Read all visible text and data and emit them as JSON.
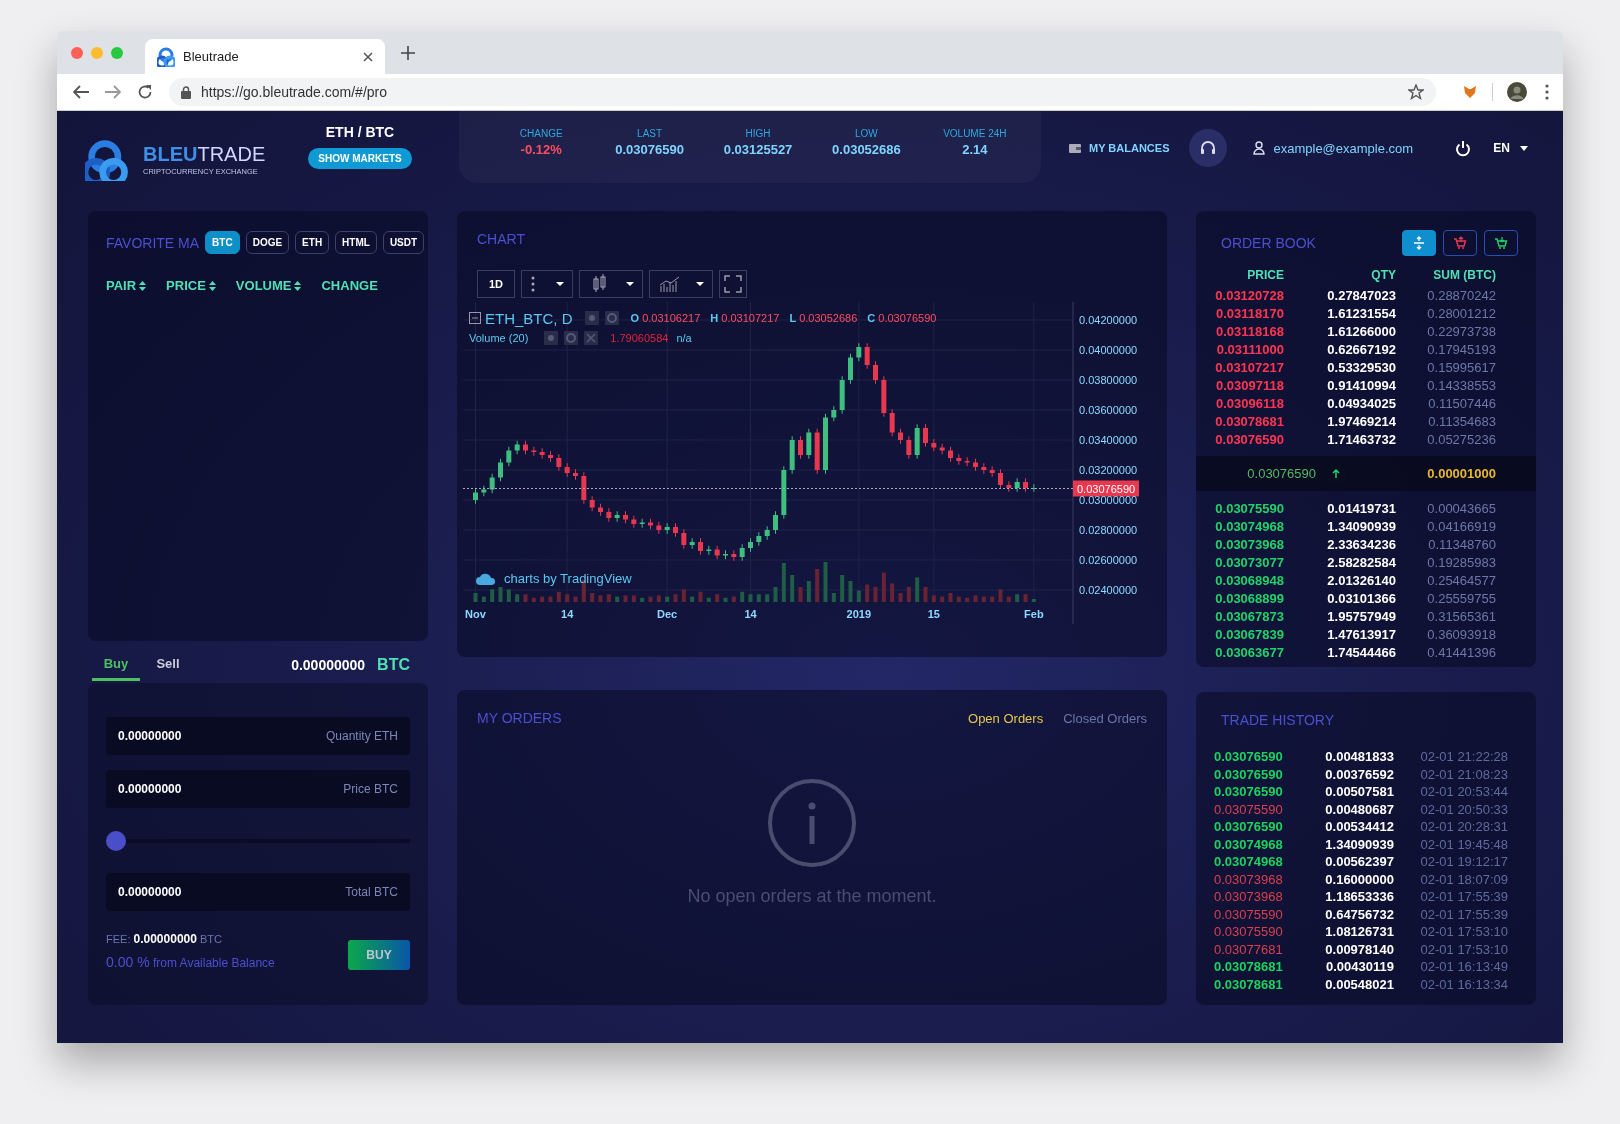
{
  "browser": {
    "tab_title": "Bleutrade",
    "url": "https://go.bleutrade.com/#/pro"
  },
  "header": {
    "logo_text": "**BLEU**TRADE",
    "logo_tagline": "CRIPTOCURRENCY EXCHANGE",
    "pair": "ETH / BTC",
    "show_markets": "SHOW MARKETS",
    "stats": [
      {
        "label": "CHANGE",
        "value": "-0.12%",
        "color": "#ff4d5e"
      },
      {
        "label": "LAST",
        "value": "0.03076590",
        "color": "#7fd4ff"
      },
      {
        "label": "HIGH",
        "value": "0.03125527",
        "color": "#7fd4ff"
      },
      {
        "label": "LOW",
        "value": "0.03052686",
        "color": "#7fd4ff"
      },
      {
        "label": "VOLUME 24H",
        "value": "2.14",
        "color": "#7fd4ff"
      }
    ],
    "balances": "MY BALANCES",
    "email": "example@example.com",
    "language": "EN"
  },
  "favorites": {
    "title": "FAVORITE MA",
    "tabs": [
      {
        "label": "BTC",
        "selected": true
      },
      {
        "label": "DOGE",
        "selected": false
      },
      {
        "label": "ETH",
        "selected": false
      },
      {
        "label": "HTML",
        "selected": false
      },
      {
        "label": "USDT",
        "selected": false
      }
    ],
    "columns": [
      {
        "label": "PAIR",
        "sortable": true
      },
      {
        "label": "PRICE",
        "sortable": true
      },
      {
        "label": "VOLUME",
        "sortable": true
      },
      {
        "label": "CHANGE",
        "sortable": false
      }
    ]
  },
  "trade_form": {
    "tabs": [
      {
        "label": "Buy",
        "selected": true
      },
      {
        "label": "Sell",
        "selected": false
      }
    ],
    "balance": "0.00000000",
    "balance_currency": "BTC",
    "fields": [
      {
        "value": "0.00000000",
        "label": "Quantity ETH"
      },
      {
        "value": "0.00000000",
        "label": "Price BTC"
      },
      {
        "value": "0.00000000",
        "label": "Total BTC"
      }
    ],
    "slider": {
      "level": 0
    },
    "fee_label": "FEE:",
    "fee_value": "0.00000000",
    "fee_currency": "BTC",
    "percent": "0.00 %",
    "percent_text": "from Available Balance",
    "button": "BUY"
  },
  "chart": {
    "title": "CHART",
    "interval": "1D",
    "symbol": "ETH_BTC, D",
    "ohlc": [
      {
        "key": "O",
        "value": "0.03106217"
      },
      {
        "key": "H",
        "value": "0.03107217"
      },
      {
        "key": "L",
        "value": "0.03052686"
      },
      {
        "key": "C",
        "value": "0.03076590"
      }
    ],
    "volume_label": "Volume (20)",
    "volume_value": "1.79060584",
    "volume_extra": "n/a",
    "attribution": "charts by TradingView",
    "chart_data": {
      "type": "candlestick",
      "grid": true,
      "ylim": [
        0.0232,
        0.0432
      ],
      "categories": [
        "Nov",
        null,
        null,
        null,
        null,
        null,
        null,
        null,
        null,
        null,
        null,
        "14",
        null,
        null,
        null,
        null,
        null,
        null,
        null,
        null,
        null,
        null,
        null,
        "Dec",
        null,
        null,
        null,
        null,
        null,
        null,
        null,
        null,
        null,
        "14",
        null,
        null,
        null,
        null,
        null,
        null,
        null,
        null,
        null,
        null,
        null,
        null,
        "2019",
        null,
        null,
        null,
        null,
        null,
        null,
        null,
        null,
        "15",
        null,
        null,
        null,
        null,
        null,
        null,
        null,
        null,
        null,
        null,
        null,
        "Feb"
      ],
      "ohlc": [
        [
          0.03,
          0.03075,
          0.02975,
          0.0305
        ],
        [
          0.0305,
          0.03095,
          0.03025,
          0.0307
        ],
        [
          0.0307,
          0.03175,
          0.03045,
          0.0315
        ],
        [
          0.0315,
          0.03275,
          0.03125,
          0.0325
        ],
        [
          0.0325,
          0.03355,
          0.03225,
          0.0333
        ],
        [
          0.0333,
          0.03395,
          0.03305,
          0.0337
        ],
        [
          0.0337,
          0.03395,
          0.03305,
          0.0333
        ],
        [
          0.0333,
          0.03355,
          0.03295,
          0.0332
        ],
        [
          0.0332,
          0.03345,
          0.03275,
          0.033
        ],
        [
          0.033,
          0.03325,
          0.03255,
          0.0328
        ],
        [
          0.0328,
          0.03305,
          0.03195,
          0.0322
        ],
        [
          0.0322,
          0.03245,
          0.03155,
          0.0318
        ],
        [
          0.0318,
          0.03205,
          0.03135,
          0.0316
        ],
        [
          0.0316,
          0.03185,
          0.02975,
          0.03
        ],
        [
          0.03,
          0.03025,
          0.02925,
          0.0295
        ],
        [
          0.0295,
          0.02975,
          0.02895,
          0.0292
        ],
        [
          0.0292,
          0.02945,
          0.02855,
          0.0288
        ],
        [
          0.0288,
          0.02925,
          0.02855,
          0.029
        ],
        [
          0.029,
          0.02925,
          0.02845,
          0.0287
        ],
        [
          0.0287,
          0.02895,
          0.02815,
          0.0284
        ],
        [
          0.0284,
          0.02875,
          0.02815,
          0.0285
        ],
        [
          0.0285,
          0.02875,
          0.02805,
          0.0283
        ],
        [
          0.0283,
          0.02855,
          0.02775,
          0.028
        ],
        [
          0.028,
          0.02845,
          0.02775,
          0.0282
        ],
        [
          0.0282,
          0.02845,
          0.02755,
          0.0278
        ],
        [
          0.0278,
          0.02805,
          0.02675,
          0.027
        ],
        [
          0.027,
          0.02745,
          0.02675,
          0.0272
        ],
        [
          0.0272,
          0.02745,
          0.02635,
          0.0266
        ],
        [
          0.0266,
          0.02695,
          0.02635,
          0.0267
        ],
        [
          0.0267,
          0.02695,
          0.02605,
          0.0263
        ],
        [
          0.0263,
          0.02665,
          0.02605,
          0.0264
        ],
        [
          0.0264,
          0.02665,
          0.02595,
          0.0262
        ],
        [
          0.0262,
          0.02705,
          0.02595,
          0.0268
        ],
        [
          0.0268,
          0.02745,
          0.02655,
          0.0272
        ],
        [
          0.0272,
          0.02785,
          0.02695,
          0.0276
        ],
        [
          0.0276,
          0.02825,
          0.02735,
          0.028
        ],
        [
          0.028,
          0.02925,
          0.02775,
          0.029
        ],
        [
          0.029,
          0.03225,
          0.02875,
          0.032
        ],
        [
          0.032,
          0.03425,
          0.03175,
          0.034
        ],
        [
          0.034,
          0.03425,
          0.03275,
          0.033
        ],
        [
          0.033,
          0.03475,
          0.03275,
          0.0345
        ],
        [
          0.0345,
          0.03475,
          0.03175,
          0.032
        ],
        [
          0.032,
          0.03575,
          0.03175,
          0.0355
        ],
        [
          0.0355,
          0.03625,
          0.03525,
          0.036
        ],
        [
          0.036,
          0.03825,
          0.03575,
          0.038
        ],
        [
          0.038,
          0.03975,
          0.03775,
          0.0395
        ],
        [
          0.0395,
          0.04045,
          0.03925,
          0.0402
        ],
        [
          0.0402,
          0.04045,
          0.03875,
          0.039
        ],
        [
          0.039,
          0.03925,
          0.03775,
          0.038
        ],
        [
          0.038,
          0.03825,
          0.03555,
          0.0358
        ],
        [
          0.0358,
          0.03605,
          0.03425,
          0.0345
        ],
        [
          0.0345,
          0.03475,
          0.03375,
          0.034
        ],
        [
          0.034,
          0.03425,
          0.03275,
          0.033
        ],
        [
          0.033,
          0.03505,
          0.03275,
          0.0348
        ],
        [
          0.0348,
          0.03505,
          0.03355,
          0.0338
        ],
        [
          0.0338,
          0.03405,
          0.03325,
          0.0335
        ],
        [
          0.0335,
          0.03375,
          0.03305,
          0.0333
        ],
        [
          0.0333,
          0.03355,
          0.03255,
          0.0328
        ],
        [
          0.0328,
          0.03305,
          0.03235,
          0.0326
        ],
        [
          0.0326,
          0.03285,
          0.03225,
          0.0325
        ],
        [
          0.0325,
          0.03275,
          0.03195,
          0.0322
        ],
        [
          0.0322,
          0.03245,
          0.03175,
          0.032
        ],
        [
          0.032,
          0.03225,
          0.03155,
          0.0318
        ],
        [
          0.0318,
          0.03205,
          0.03075,
          0.031
        ],
        [
          0.031,
          0.03125,
          0.03055,
          0.0308
        ],
        [
          0.0308,
          0.03145,
          0.03055,
          0.0312
        ],
        [
          0.0312,
          0.03145,
          0.03055,
          0.0308
        ],
        [
          0.0308,
          0.03105,
          0.03055,
          0.0308
        ]
      ],
      "yticks": [
        {
          "value": 0.042,
          "label": "0.04200000"
        },
        {
          "value": 0.04,
          "label": "0.04000000"
        },
        {
          "value": 0.038,
          "label": "0.03800000"
        },
        {
          "value": 0.036,
          "label": "0.03600000"
        },
        {
          "value": 0.034,
          "label": "0.03400000"
        },
        {
          "value": 0.032,
          "label": "0.03200000"
        },
        {
          "value": 0.03,
          "label": "0.03000000"
        },
        {
          "value": 0.028,
          "label": "0.02800000"
        },
        {
          "value": 0.026,
          "label": "0.02600000"
        },
        {
          "value": 0.024,
          "label": "0.02400000"
        }
      ],
      "ref_lines": [
        {
          "axis": "y",
          "value": 0.0307659,
          "label": "0.03076590"
        }
      ]
    }
  },
  "my_orders": {
    "title": "MY ORDERS",
    "tabs": [
      {
        "label": "Open Orders",
        "selected": true
      },
      {
        "label": "Closed Orders",
        "selected": false
      }
    ],
    "empty_message": "No open orders at the moment."
  },
  "order_book": {
    "title": "ORDER BOOK",
    "views": [
      {
        "kind": "both",
        "selected": true
      },
      {
        "kind": "asks",
        "selected": false
      },
      {
        "kind": "bids",
        "selected": false
      }
    ],
    "columns": [
      "PRICE",
      "QTY",
      "SUM (BTC)"
    ],
    "asks": [
      [
        "0.03120728",
        "0.27847023",
        "0.28870242"
      ],
      [
        "0.03118170",
        "1.61231554",
        "0.28001212"
      ],
      [
        "0.03118168",
        "1.61266000",
        "0.22973738"
      ],
      [
        "0.03111000",
        "0.62667192",
        "0.17945193"
      ],
      [
        "0.03107217",
        "0.53329530",
        "0.15995617"
      ],
      [
        "0.03097118",
        "0.91410994",
        "0.14338553"
      ],
      [
        "0.03096118",
        "0.04934025",
        "0.11507446"
      ],
      [
        "0.03078681",
        "1.97469214",
        "0.11354683"
      ],
      [
        "0.03076590",
        "1.71463732",
        "0.05275236"
      ]
    ],
    "spread": {
      "price": "0.03076590",
      "rising": true,
      "value": "0.00001000"
    },
    "bids": [
      [
        "0.03075590",
        "0.01419731",
        "0.00043665"
      ],
      [
        "0.03074968",
        "1.34090939",
        "0.04166919"
      ],
      [
        "0.03073968",
        "2.33634236",
        "0.11348760"
      ],
      [
        "0.03073077",
        "2.58282584",
        "0.19285983"
      ],
      [
        "0.03068948",
        "2.01326140",
        "0.25464577"
      ],
      [
        "0.03068899",
        "0.03101366",
        "0.25559755"
      ],
      [
        "0.03067873",
        "1.95757949",
        "0.31565361"
      ],
      [
        "0.03067839",
        "1.47613917",
        "0.36093918"
      ],
      [
        "0.03063677",
        "1.74544466",
        "0.41441396"
      ]
    ]
  },
  "trade_history": {
    "title": "TRADE HISTORY",
    "rows": [
      {
        "kind": "buy",
        "price": "0.03076590",
        "qty": "0.00481833",
        "time": "02-01 21:22:28"
      },
      {
        "kind": "buy",
        "price": "0.03076590",
        "qty": "0.00376592",
        "time": "02-01 21:08:23"
      },
      {
        "kind": "buy",
        "price": "0.03076590",
        "qty": "0.00507581",
        "time": "02-01 20:53:44"
      },
      {
        "kind": "sell",
        "price": "0.03075590",
        "qty": "0.00480687",
        "time": "02-01 20:50:33"
      },
      {
        "kind": "buy",
        "price": "0.03076590",
        "qty": "0.00534412",
        "time": "02-01 20:28:31"
      },
      {
        "kind": "buy",
        "price": "0.03074968",
        "qty": "1.34090939",
        "time": "02-01 19:45:48"
      },
      {
        "kind": "buy",
        "price": "0.03074968",
        "qty": "0.00562397",
        "time": "02-01 19:12:17"
      },
      {
        "kind": "sell",
        "price": "0.03073968",
        "qty": "0.16000000",
        "time": "02-01 18:07:09"
      },
      {
        "kind": "sell",
        "price": "0.03073968",
        "qty": "1.18653336",
        "time": "02-01 17:55:39"
      },
      {
        "kind": "sell",
        "price": "0.03075590",
        "qty": "0.64756732",
        "time": "02-01 17:55:39"
      },
      {
        "kind": "sell",
        "price": "0.03075590",
        "qty": "1.08126731",
        "time": "02-01 17:53:10"
      },
      {
        "kind": "sell",
        "price": "0.03077681",
        "qty": "0.00978140",
        "time": "02-01 17:53:10"
      },
      {
        "kind": "buy",
        "price": "0.03078681",
        "qty": "0.00430119",
        "time": "02-01 16:13:49"
      },
      {
        "kind": "buy",
        "price": "0.03078681",
        "qty": "0.00548021",
        "time": "02-01 16:13:34"
      }
    ]
  }
}
